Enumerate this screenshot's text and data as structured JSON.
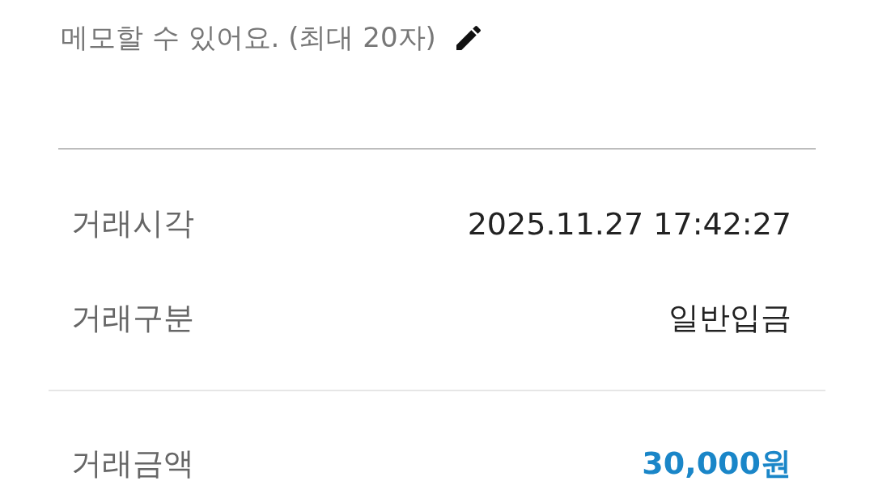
{
  "memo": {
    "hint": "메모할 수 있어요. (최대 20자)"
  },
  "details": [
    {
      "label": "거래시각",
      "value": "2025.11.27 17:42:27"
    },
    {
      "label": "거래구분",
      "value": "일반입금"
    }
  ],
  "amount": {
    "label": "거래금액",
    "value": "30,000원"
  }
}
